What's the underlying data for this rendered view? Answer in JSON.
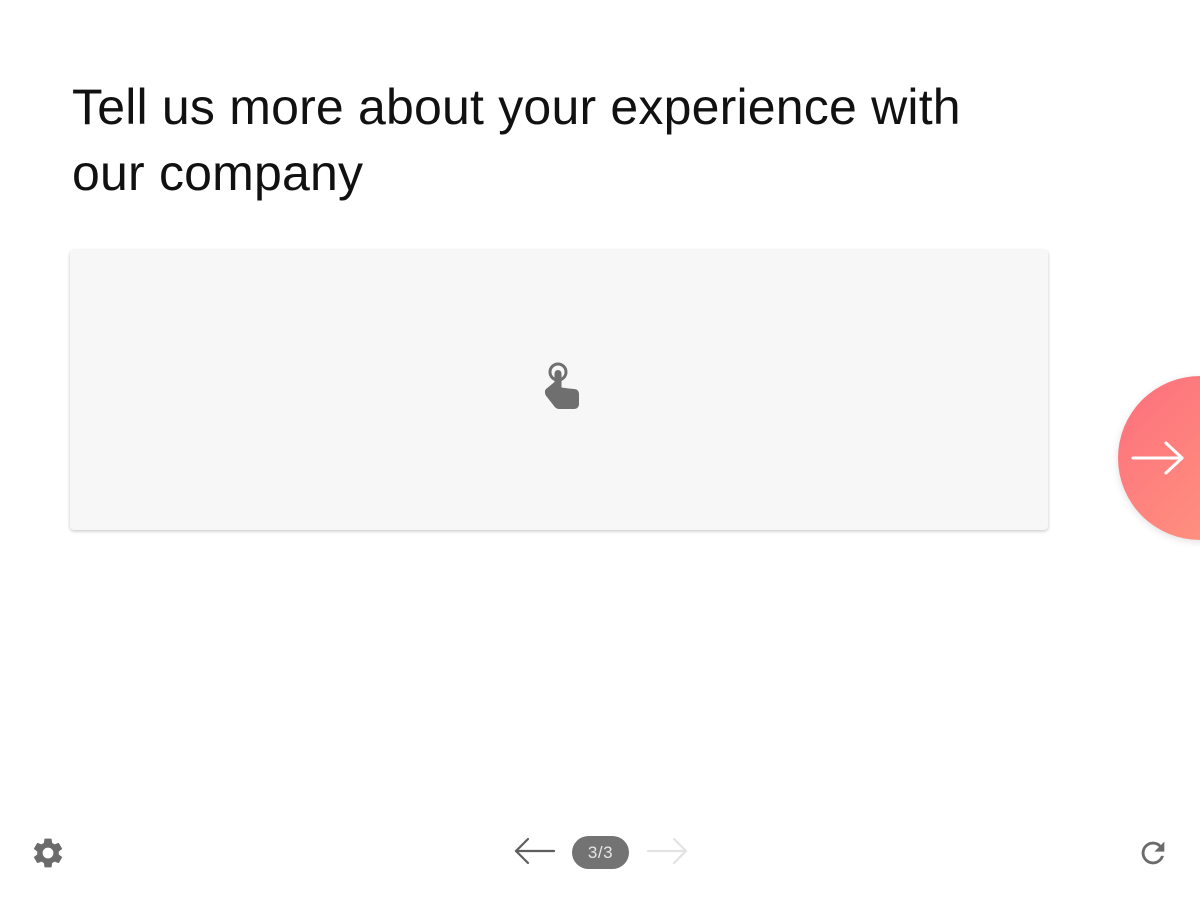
{
  "question": {
    "title": "Tell us more about your experience with our company"
  },
  "tap_area": {
    "icon": "tap-finger-icon"
  },
  "navigation": {
    "next_fab_icon": "arrow-right-icon",
    "prev_icon": "arrow-left-icon",
    "next_icon": "arrow-right-icon",
    "counter": "3/3"
  },
  "footer": {
    "settings_icon": "gear-icon",
    "refresh_icon": "refresh-icon"
  },
  "colors": {
    "accent_start": "#fd6f7c",
    "accent_end": "#fe9a80",
    "counter_bg": "#737373",
    "tap_area_bg": "#f7f7f7"
  }
}
